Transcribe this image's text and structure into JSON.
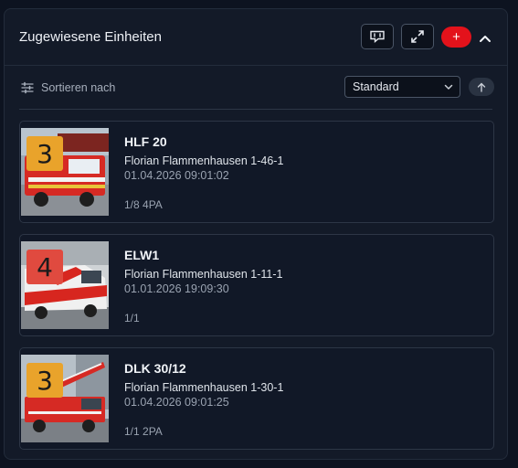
{
  "header": {
    "title": "Zugewiesene Einheiten",
    "add_label": "+"
  },
  "sort": {
    "label": "Sortieren nach",
    "selected": "Standard"
  },
  "colors": {
    "accent_red": "#e3121b",
    "badge_3": "#e9a32b",
    "badge_4": "#e04a3f"
  },
  "units": [
    {
      "status": "3",
      "name": "HLF 20",
      "station": "Florian Flammenhausen 1-46-1",
      "time": "01.04.2026 09:01:02",
      "crew": "1/8 4PA"
    },
    {
      "status": "4",
      "name": "ELW1",
      "station": "Florian Flammenhausen 1-11-1",
      "time": "01.01.2026 19:09:30",
      "crew": "1/1"
    },
    {
      "status": "3",
      "name": "DLK 30/12",
      "station": "Florian Flammenhausen 1-30-1",
      "time": "01.04.2026 09:01:25",
      "crew": "1/1 2PA"
    }
  ]
}
